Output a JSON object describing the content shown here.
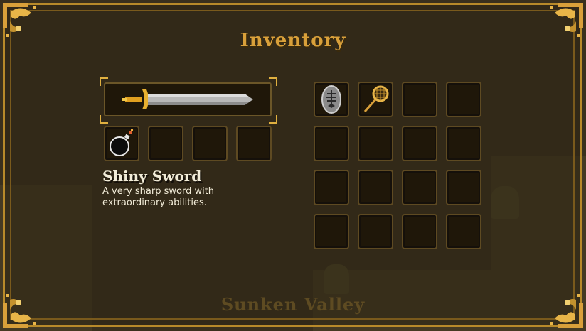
{
  "window": {
    "title": "Inventory",
    "footer": "Sunken Valley"
  },
  "selected_item": {
    "name": "Shiny Sword",
    "description_lines": [
      "A very sharp sword with",
      "extraordinary abilities."
    ]
  },
  "equipment": {
    "weapon_icon": "sword-icon",
    "quick_slots": [
      {
        "icon": "bomb-icon"
      },
      {
        "icon": null
      },
      {
        "icon": null
      },
      {
        "icon": null
      }
    ]
  },
  "backpack": {
    "slots": [
      {
        "icon": "fish-fossil-icon"
      },
      {
        "icon": "fishing-net-icon"
      },
      {
        "icon": null
      },
      {
        "icon": null
      },
      {
        "icon": null
      },
      {
        "icon": null
      },
      {
        "icon": null
      },
      {
        "icon": null
      },
      {
        "icon": null
      },
      {
        "icon": null
      },
      {
        "icon": null
      },
      {
        "icon": null
      },
      {
        "icon": null
      },
      {
        "icon": null
      },
      {
        "icon": null
      },
      {
        "icon": null
      }
    ]
  },
  "colors": {
    "frame_gold": "#b88a2a",
    "title_gold": "#d9a03a",
    "slot_bg": "#1f1709",
    "text": "#f2ecd8"
  }
}
